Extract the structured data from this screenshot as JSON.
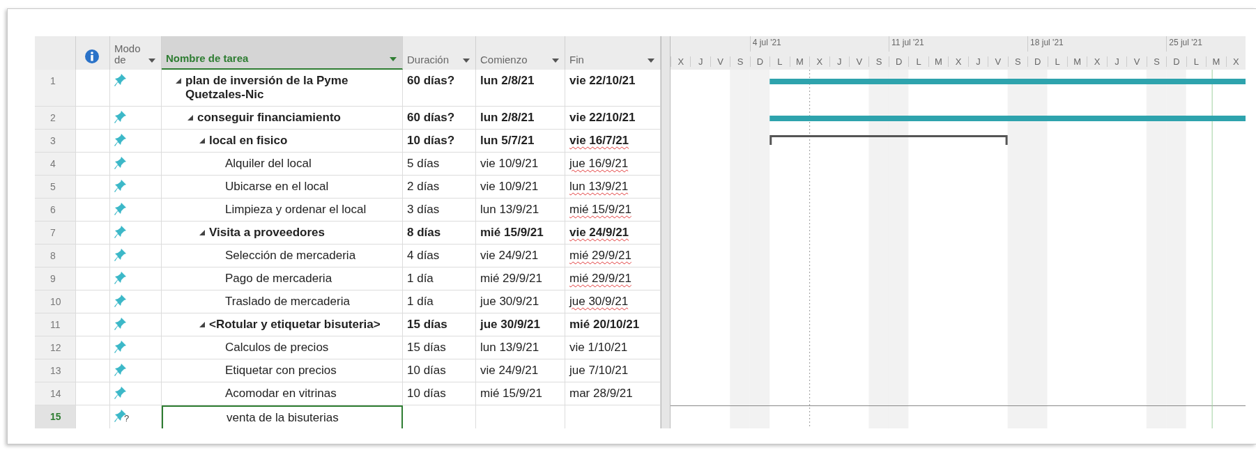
{
  "columns": {
    "mode": "Modo de",
    "name": "Nombre de tarea",
    "duration": "Duración",
    "start": "Comienzo",
    "finish": "Fin"
  },
  "tasks": [
    {
      "id": "1",
      "mode": {
        "kind": "manual"
      },
      "name": "plan de inversión de la Pyme Quetzales-Nic",
      "kind": "summary",
      "expanded": true,
      "duration": "60 días?",
      "start": "lun 2/8/21",
      "finish": "vie 22/10/21",
      "spell_error": false,
      "selected": false,
      "bar": {
        "kind": "summary"
      },
      "children": [
        {
          "id": "2",
          "mode": {
            "kind": "manual"
          },
          "name": "conseguir financiamiento",
          "kind": "summary",
          "expanded": true,
          "duration": "60 días?",
          "start": "lun 2/8/21",
          "finish": "vie 22/10/21",
          "spell_error": false,
          "selected": false,
          "bar": {
            "kind": "summary"
          },
          "children": [
            {
              "id": "3",
              "mode": {
                "kind": "manual"
              },
              "name": "local en fisico",
              "kind": "summary",
              "expanded": true,
              "duration": "10 días?",
              "start": "lun 5/7/21",
              "finish": "vie 16/7/21",
              "spell_error": true,
              "selected": false,
              "bar": {
                "kind": "bracket"
              },
              "children": [
                {
                  "id": "4",
                  "mode": {
                    "kind": "manual"
                  },
                  "name": "Alquiler del local",
                  "kind": "task",
                  "duration": "5 días",
                  "start": "vie 10/9/21",
                  "finish": "jue 16/9/21",
                  "spell_error": true,
                  "selected": false
                },
                {
                  "id": "5",
                  "mode": {
                    "kind": "manual"
                  },
                  "name": "Ubicarse en el local",
                  "kind": "task",
                  "duration": "2 días",
                  "start": "vie 10/9/21",
                  "finish": "lun 13/9/21",
                  "spell_error": true,
                  "selected": false
                },
                {
                  "id": "6",
                  "mode": {
                    "kind": "manual"
                  },
                  "name": "Limpieza y ordenar el local",
                  "kind": "task",
                  "duration": "3 días",
                  "start": "lun 13/9/21",
                  "finish": "mié 15/9/21",
                  "spell_error": true,
                  "selected": false
                }
              ]
            },
            {
              "id": "7",
              "mode": {
                "kind": "manual"
              },
              "name": "Visita a proveedores",
              "kind": "summary",
              "expanded": true,
              "duration": "8 días",
              "start": "mié 15/9/21",
              "finish": "vie 24/9/21",
              "spell_error": true,
              "selected": false,
              "children": [
                {
                  "id": "8",
                  "mode": {
                    "kind": "manual"
                  },
                  "name": "Selección de mercaderia",
                  "kind": "task",
                  "duration": "4 días",
                  "start": "vie 24/9/21",
                  "finish": "mié 29/9/21",
                  "spell_error": true,
                  "selected": false
                },
                {
                  "id": "9",
                  "mode": {
                    "kind": "manual"
                  },
                  "name": "Pago de mercaderia",
                  "kind": "task",
                  "duration": "1 día",
                  "start": "mié 29/9/21",
                  "finish": "mié 29/9/21",
                  "spell_error": true,
                  "selected": false
                },
                {
                  "id": "10",
                  "mode": {
                    "kind": "manual"
                  },
                  "name": "Traslado de mercaderia",
                  "kind": "task",
                  "duration": "1 día",
                  "start": "jue 30/9/21",
                  "finish": "jue 30/9/21",
                  "spell_error": true,
                  "selected": false
                }
              ]
            },
            {
              "id": "11",
              "mode": {
                "kind": "manual"
              },
              "name": "<Rotular y etiquetar bisuteria>",
              "kind": "summary",
              "expanded": true,
              "duration": "15 días",
              "start": "jue 30/9/21",
              "finish": "mié 20/10/21",
              "spell_error": false,
              "selected": false,
              "children": [
                {
                  "id": "12",
                  "mode": {
                    "kind": "manual"
                  },
                  "name": "Calculos de precios",
                  "kind": "task",
                  "duration": "15 días",
                  "start": "lun 13/9/21",
                  "finish": "vie 1/10/21",
                  "spell_error": false,
                  "selected": false
                },
                {
                  "id": "13",
                  "mode": {
                    "kind": "manual"
                  },
                  "name": "Etiquetar con precios",
                  "kind": "task",
                  "duration": "10 días",
                  "start": "vie 24/9/21",
                  "finish": "jue 7/10/21",
                  "spell_error": false,
                  "selected": false
                },
                {
                  "id": "14",
                  "mode": {
                    "kind": "manual"
                  },
                  "name": "Acomodar en vitrinas",
                  "kind": "task",
                  "duration": "10 días",
                  "start": "mié 15/9/21",
                  "finish": "mar 28/9/21",
                  "spell_error": false,
                  "selected": false
                },
                {
                  "id": "15",
                  "mode": {
                    "kind": "unknown",
                    "mark": "?"
                  },
                  "name": "venta de la bisuterias",
                  "kind": "task",
                  "selected": true
                }
              ]
            }
          ]
        }
      ]
    }
  ],
  "gantt": {
    "days": [
      {
        "letter": "X",
        "weekend": false
      },
      {
        "letter": "J",
        "weekend": false
      },
      {
        "letter": "V",
        "weekend": false
      },
      {
        "letter": "S",
        "weekend": true
      },
      {
        "letter": "D",
        "weekend": true,
        "week": "4 jul '21"
      },
      {
        "letter": "L",
        "weekend": false
      },
      {
        "letter": "M",
        "weekend": false
      },
      {
        "letter": "X",
        "weekend": false
      },
      {
        "letter": "J",
        "weekend": false
      },
      {
        "letter": "V",
        "weekend": false
      },
      {
        "letter": "S",
        "weekend": true
      },
      {
        "letter": "D",
        "weekend": true,
        "week": "11 jul '21"
      },
      {
        "letter": "L",
        "weekend": false
      },
      {
        "letter": "M",
        "weekend": false
      },
      {
        "letter": "X",
        "weekend": false
      },
      {
        "letter": "J",
        "weekend": false
      },
      {
        "letter": "V",
        "weekend": false
      },
      {
        "letter": "S",
        "weekend": true
      },
      {
        "letter": "D",
        "weekend": true,
        "week": "18 jul '21"
      },
      {
        "letter": "L",
        "weekend": false
      },
      {
        "letter": "M",
        "weekend": false
      },
      {
        "letter": "X",
        "weekend": false
      },
      {
        "letter": "J",
        "weekend": false
      },
      {
        "letter": "V",
        "weekend": false
      },
      {
        "letter": "S",
        "weekend": true
      },
      {
        "letter": "D",
        "weekend": true,
        "week": "25 jul '21"
      },
      {
        "letter": "L",
        "weekend": false
      },
      {
        "letter": "M",
        "weekend": false
      },
      {
        "letter": "X",
        "weekend": false
      }
    ],
    "markers": [
      {
        "kind": "dotted"
      },
      {
        "kind": "current"
      }
    ]
  }
}
